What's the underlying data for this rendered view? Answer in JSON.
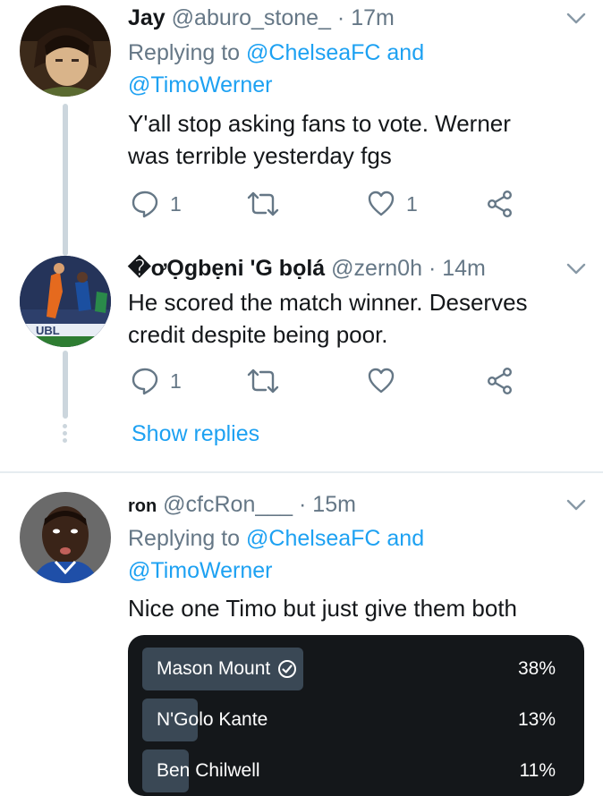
{
  "tweets": [
    {
      "display_name": "Jay",
      "handle": "@aburo_stone_",
      "time": "· 17m",
      "replying_prefix": "Replying to",
      "replying_to_1": "@ChelseaFC and",
      "replying_to_2": "@TimoWerner",
      "text_line_1": "Y'all stop asking fans to vote. Werner",
      "text_line_2": "was terrible yesterday fgs",
      "reply_count": "1",
      "like_count": "1"
    },
    {
      "display_name": "�ơỌgbẹni 'G bọlá",
      "handle": "@zern0h",
      "time": "· 14m",
      "text_line_1": "He scored the match winner. Deserves",
      "text_line_2": "credit despite being poor.",
      "reply_count": "1",
      "like_count": "",
      "avatar_overlay_text": "UBL"
    },
    {
      "display_name": "ron",
      "handle": "@cfcRon___",
      "time": "· 15m",
      "replying_prefix": "Replying to",
      "replying_to_1": "@ChelseaFC and",
      "replying_to_2": "@TimoWerner",
      "text_line_1": "Nice one Timo but just give them both"
    }
  ],
  "show_replies": "Show replies",
  "poll": {
    "options": [
      {
        "label": "Mason Mount",
        "percent": "38%",
        "value": 38,
        "selected": true
      },
      {
        "label": "N'Golo Kante",
        "percent": "13%",
        "value": 13,
        "selected": false
      },
      {
        "label": "Ben Chilwell",
        "percent": "11%",
        "value": 11,
        "selected": false
      }
    ]
  },
  "icons": {
    "reply": "reply-icon",
    "retweet": "retweet-icon",
    "like": "heart-icon",
    "share": "share-icon",
    "more": "chevron-down-icon",
    "voted": "check-circle-icon"
  },
  "colors": {
    "link": "#1da1f2",
    "muted": "#657786",
    "thread_line": "#ccd6dd",
    "poll_bg": "#14171a",
    "poll_bar": "#3a4855"
  }
}
